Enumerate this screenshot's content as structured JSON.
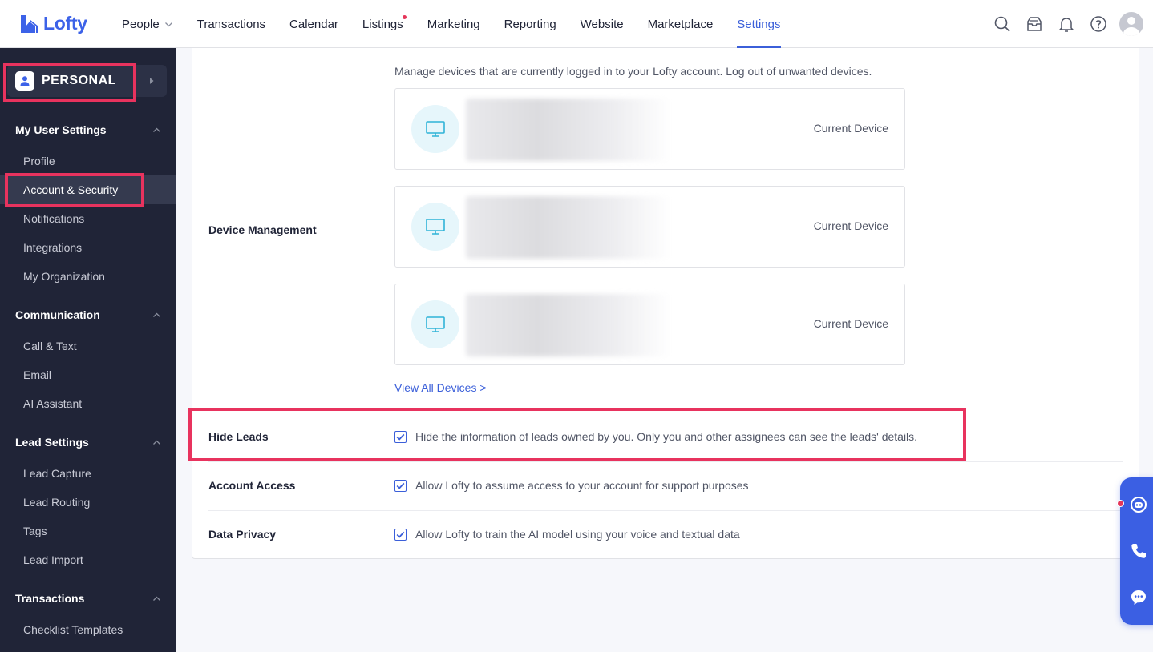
{
  "app": {
    "logo_text": "Lofty",
    "brand_color": "#3c62e8",
    "highlight_color": "#e8335e"
  },
  "nav": {
    "items": [
      {
        "label": "People",
        "icon": "chevron-down-icon"
      },
      {
        "label": "Transactions"
      },
      {
        "label": "Calendar"
      },
      {
        "label": "Listings",
        "badge": "red-dot"
      },
      {
        "label": "Marketing"
      },
      {
        "label": "Reporting"
      },
      {
        "label": "Website"
      },
      {
        "label": "Marketplace"
      },
      {
        "label": "Settings",
        "active": true
      }
    ],
    "icons": [
      "search-icon",
      "inbox-icon",
      "bell-icon",
      "help-icon",
      "avatar"
    ]
  },
  "sidebar": {
    "persona": "PERSONAL",
    "groups": [
      {
        "title": "My User Settings",
        "items": [
          "Profile",
          "Account & Security",
          "Notifications",
          "Integrations",
          "My Organization"
        ],
        "active": "Account & Security"
      },
      {
        "title": "Communication",
        "items": [
          "Call & Text",
          "Email",
          "AI Assistant"
        ]
      },
      {
        "title": "Lead Settings",
        "items": [
          "Lead Capture",
          "Lead Routing",
          "Tags",
          "Lead Import"
        ]
      },
      {
        "title": "Transactions",
        "items": [
          "Checklist Templates"
        ]
      }
    ]
  },
  "device_management": {
    "label": "Device Management",
    "description": "Manage devices that are currently logged in to your Lofty account. Log out of unwanted devices.",
    "devices": [
      {
        "icon": "monitor-icon",
        "status": "Current Device"
      },
      {
        "icon": "monitor-icon",
        "status": "Current Device"
      },
      {
        "icon": "monitor-icon",
        "status": "Current Device"
      }
    ],
    "view_all": "View All Devices >"
  },
  "settings_rows": [
    {
      "label": "Hide Leads",
      "checked": true,
      "text": "Hide the information of leads owned by you. Only you and other assignees can see the leads' details."
    },
    {
      "label": "Account Access",
      "checked": true,
      "text": "Allow Lofty to assume access to your account for support purposes"
    },
    {
      "label": "Data Privacy",
      "checked": true,
      "text": "Allow Lofty to train the AI model using your voice and textual data"
    }
  ],
  "widget": {
    "icons": [
      "assistant-bot-icon",
      "phone-icon",
      "chat-icon"
    ]
  }
}
